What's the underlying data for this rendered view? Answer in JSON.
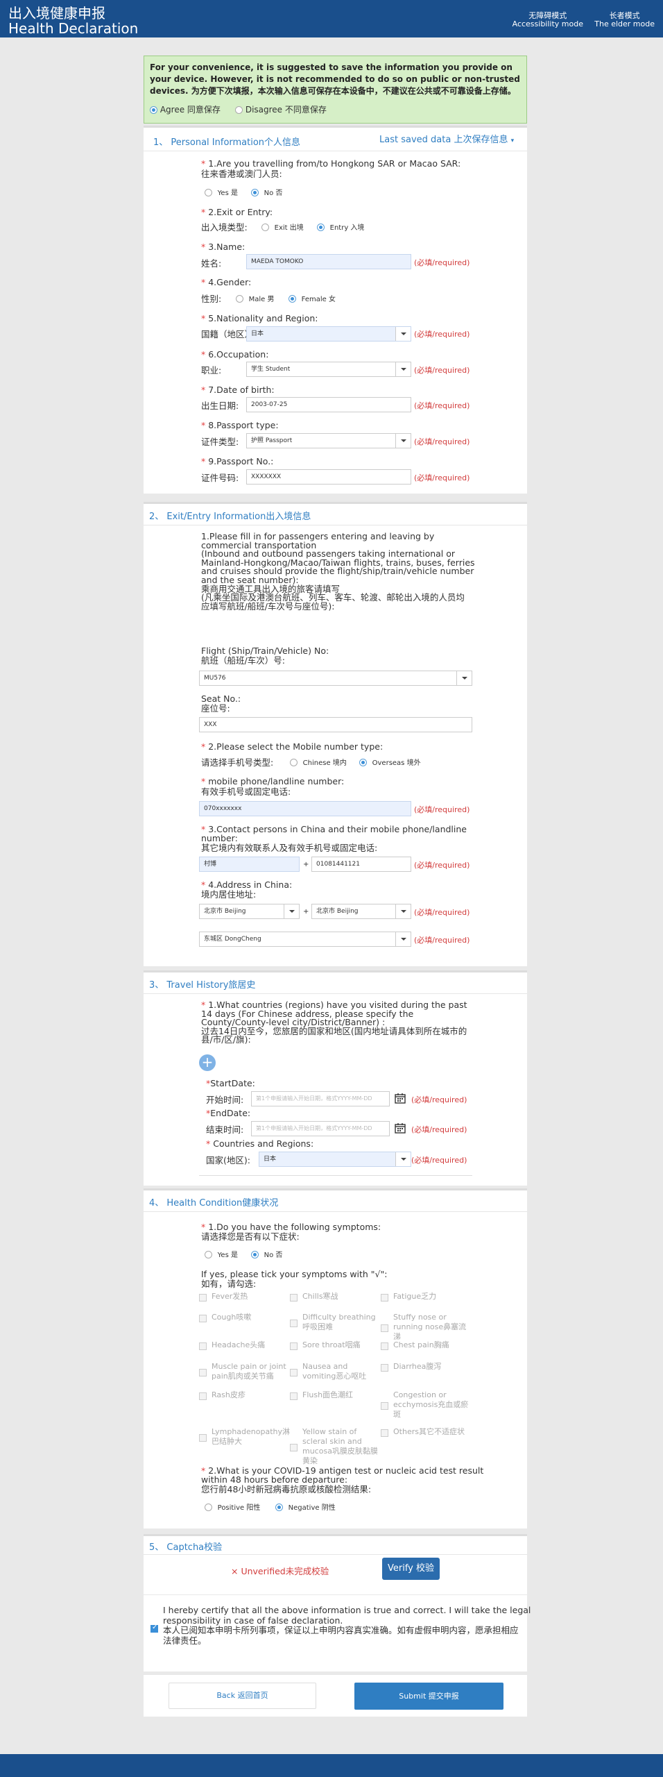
{
  "header": {
    "title_cn": "出入境健康申报",
    "title_en": "Health Declaration",
    "accessibility_cn": "无障碍模式",
    "accessibility_en": "Accessibility mode",
    "elder_cn": "长者模式",
    "elder_en": "The elder mode"
  },
  "notice": {
    "text": "For your convenience, it is suggested to save the information you provide on your device. However, it is not recommended to do so on public or non-trusted devices. 为方便下次填报，本次输入信息可保存在本设备中，不建议在公共或不可靠设备上存储。",
    "agree": "Agree 同意保存",
    "disagree": "Disagree 不同意保存"
  },
  "required_text": "(必填/required)",
  "personal": {
    "title": "1、 Personal Information个人信息",
    "last_saved": "Last saved data 上次保存信息",
    "q1_en": "1.Are you travelling from/to Hongkong SAR or Macao SAR:",
    "q1_cn": "往来香港或澳门人员:",
    "yes": "Yes 是",
    "no": "No 否",
    "q2_en": "2.Exit or Entry:",
    "q2_cn": "出入境类型:",
    "exit": "Exit 出境",
    "entry": "Entry 入境",
    "q3_en": "3.Name:",
    "q3_cn": "姓名:",
    "name_value": "MAEDA TOMOKO",
    "q4_en": "4.Gender:",
    "q4_cn": "性别:",
    "male": "Male 男",
    "female": "Female 女",
    "q5_en": "5.Nationality and Region:",
    "q5_cn": "国籍（地区）:",
    "nationality_value": "日本",
    "q6_en": "6.Occupation:",
    "q6_cn": "职业:",
    "occupation_value": "学生 Student",
    "q7_en": "7.Date of birth:",
    "q7_cn": "出生日期:",
    "dob_value": "2003-07-25",
    "q8_en": "8.Passport type:",
    "q8_cn": "证件类型:",
    "passport_type_value": "护照 Passport",
    "q9_en": "9.Passport No.:",
    "q9_cn": "证件号码:",
    "passport_no_value": "XXXXXXX"
  },
  "exit_entry": {
    "title": "2、 Exit/Entry Information出入境信息",
    "intro": [
      "1.Please fill in for passengers entering and leaving by",
      "commercial transportation",
      "(Inbound and outbound passengers taking international or",
      "Mainland-Hongkong/Macao/Taiwan flights, trains, buses, ferries",
      "and cruises should provide the flight/ship/train/vehicle number",
      "and the seat number):",
      "乘商用交通工具出入境的旅客请填写",
      "(凡乘坐国际及港澳台航班、列车、客车、轮渡、邮轮出入境的人员均",
      "应填写航班/船班/车次号与座位号):"
    ],
    "flight_en": "Flight (Ship/Train/Vehicle) No:",
    "flight_cn": "航班（船班/车次）号:",
    "flight_value": "MU576",
    "seat_en": "Seat No.:",
    "seat_cn": "座位号:",
    "seat_value": "XXX",
    "mobile_type_en": "2.Please select the Mobile number type:",
    "mobile_type_cn": "请选择手机号类型:",
    "chinese": "Chinese 境内",
    "overseas": "Overseas 境外",
    "mobile_en": "mobile phone/landline number:",
    "mobile_cn": "有效手机号或固定电话:",
    "mobile_value": "070xxxxxxx",
    "contact_en1": "3.Contact persons in China and their mobile phone/landline",
    "contact_en2": "number:",
    "contact_cn": "其它境内有效联系人及有效手机号或固定电话:",
    "contact_name": "村博",
    "contact_plus": "+",
    "contact_phone": "01081441121",
    "address_en": "4.Address in China:",
    "address_cn": "境内居住地址:",
    "city1": "北京市 Beijing",
    "addr_plus": "+",
    "city2": "北京市 Beijing",
    "district": "东城区 DongCheng"
  },
  "travel": {
    "title": "3、 Travel History旅居史",
    "q1": [
      "1.What countries (regions) have you visited during the past",
      "14 days (For Chinese address, please specify the",
      "County/County-level city/District/Banner) :",
      "过去14日内至今，您旅居的国家和地区(国内地址请具体到所在城市的",
      "县/市/区/旗):"
    ],
    "plus": "+",
    "start_en": "StartDate:",
    "start_cn": "开始时间:",
    "start_ph": "第1个申报请输入开始日期，格式YYYY-MM-DD",
    "end_en": "EndDate:",
    "end_cn": "结束时间:",
    "end_ph": "第1个申报请输入开始日期，格式YYYY-MM-DD",
    "country_en": "Countries and Regions:",
    "country_cn": "国家(地区):",
    "country_value": "日本"
  },
  "health": {
    "title": "4、 Health Condition健康状况",
    "q1_en": "1.Do you have the following symptoms:",
    "q1_cn": "请选择您是否有以下症状:",
    "yes": "Yes 是",
    "no": "No 否",
    "tick_en": "If yes, please tick your symptoms with \"√\":",
    "tick_cn": "如有，请勾选:",
    "symptoms": [
      [
        "Fever发热"
      ],
      [
        "Chills寒战"
      ],
      [
        "Fatigue乏力"
      ],
      [
        "Cough咳嗽"
      ],
      [
        "Difficulty breathing",
        "呼吸困难"
      ],
      [
        "Stuffy nose or",
        "running nose鼻塞流",
        "涕"
      ],
      [
        "Headache头痛"
      ],
      [
        "Sore throat咽痛"
      ],
      [
        "Chest pain胸痛"
      ],
      [
        "Muscle pain or joint",
        "pain肌肉或关节痛"
      ],
      [
        "Nausea and",
        "vomiting恶心呕吐"
      ],
      [
        "Diarrhea腹泻"
      ],
      [
        "Rash皮疹"
      ],
      [
        "Flush面色潮红"
      ],
      [
        "Congestion or",
        "ecchymosis充血或瘀",
        "斑"
      ],
      [
        "Lymphadenopathy淋",
        "巴结肿大"
      ],
      [
        "Yellow stain of",
        "scleral skin and",
        "mucosa巩膜皮肤黏膜",
        "黄染"
      ],
      [
        "Others其它不适症状"
      ]
    ],
    "q2_en1": "2.What is your COVID-19 antigen test or nucleic acid test result",
    "q2_en2": "within 48 hours before departure:",
    "q2_cn": "您行前48小时新冠病毒抗原或核酸检测结果:",
    "positive": "Positive 阳性",
    "negative": "Negative 阴性"
  },
  "captcha": {
    "title": "5、 Captcha校验",
    "status": "× Unverified未完成校验",
    "verify": "Verify 校验"
  },
  "certify": {
    "en1": "I hereby certify that all the above information is true and correct. I will take the legal",
    "en2": "responsibility in case of false declaration.",
    "cn1": "本人已阅知本申明卡所列事项，保证以上申明内容真实准确。如有虚假申明内容，愿承担相应",
    "cn2": "法律责任。"
  },
  "actions": {
    "back": "Back 返回首页",
    "submit": "Submit 提交申报"
  },
  "icons": {
    "check": "checkmark-icon",
    "calendar": "calendar-icon",
    "dropdown": "chevron-down-icon",
    "add": "plus-circle-icon"
  },
  "colors": {
    "header": "#1a4f8c",
    "accent": "#2f7ec2",
    "required": "#d23c3c",
    "notice_bg": "#d6efc7"
  }
}
